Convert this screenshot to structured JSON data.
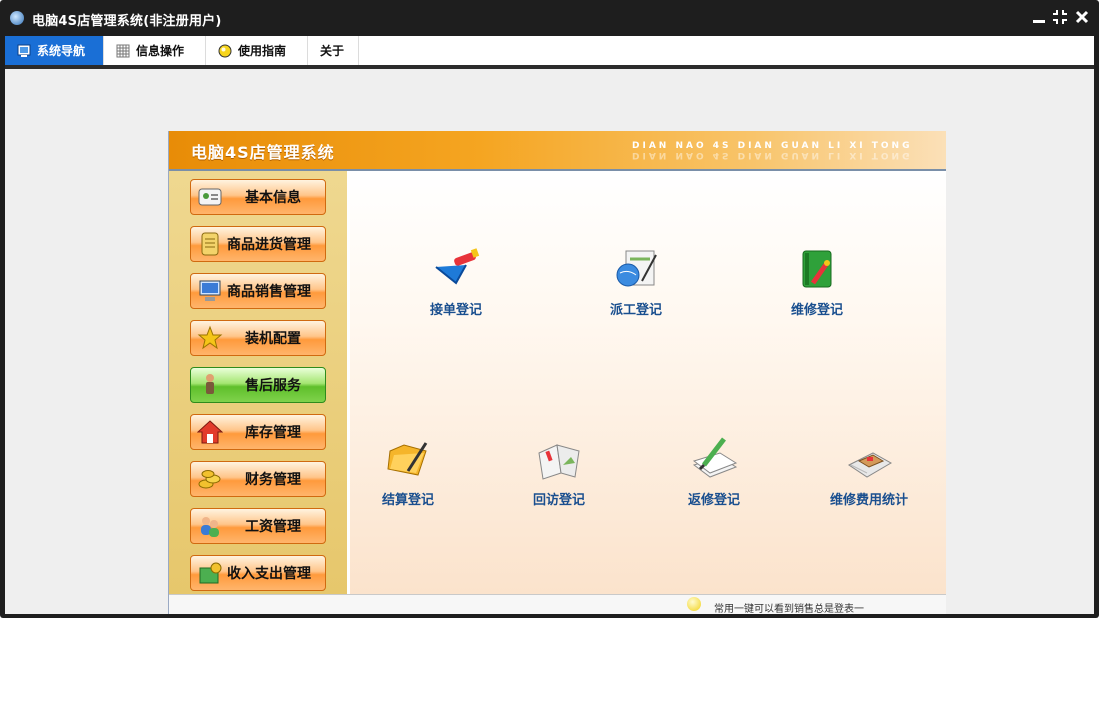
{
  "window": {
    "title": "电脑4S店管理系统(非注册用户)"
  },
  "menu": {
    "items": [
      {
        "label": "系统导航",
        "icon": "monitor-icon"
      },
      {
        "label": "信息操作",
        "icon": "grid-icon"
      },
      {
        "label": "使用指南",
        "icon": "bulb-icon"
      },
      {
        "label": "关于",
        "icon": ""
      }
    ],
    "active_index": 0
  },
  "banner": {
    "title": "电脑4S店管理系统",
    "subtitle": "DIAN NAO 4S DIAN GUAN LI XI TONG"
  },
  "sidebar": {
    "items": [
      {
        "label": "基本信息",
        "icon": "id-card-icon"
      },
      {
        "label": "商品进货管理",
        "icon": "document-icon"
      },
      {
        "label": "商品销售管理",
        "icon": "computer-icon"
      },
      {
        "label": "装机配置",
        "icon": "star-icon"
      },
      {
        "label": "售后服务",
        "icon": "person-icon"
      },
      {
        "label": "库存管理",
        "icon": "house-icon"
      },
      {
        "label": "财务管理",
        "icon": "coins-icon"
      },
      {
        "label": "工资管理",
        "icon": "users-icon"
      },
      {
        "label": "收入支出管理",
        "icon": "money-box-icon"
      }
    ],
    "selected_index": 4
  },
  "functions": {
    "items": [
      {
        "label": "接单登记",
        "icon": "clipboard-pencil-icon"
      },
      {
        "label": "派工登记",
        "icon": "globe-document-icon"
      },
      {
        "label": "维修登记",
        "icon": "green-book-icon"
      },
      {
        "label": "结算登记",
        "icon": "folder-pen-icon"
      },
      {
        "label": "回访登记",
        "icon": "open-book-icon"
      },
      {
        "label": "返修登记",
        "icon": "notepad-pencil-icon"
      },
      {
        "label": "维修费用统计",
        "icon": "calculator-icon"
      }
    ]
  },
  "status": {
    "text": "常用一键可以看到销售总是登表一"
  },
  "colors": {
    "accent": "#1a6fd6",
    "banner": "#f5a521",
    "selected_button": "#5fbf2b",
    "label_blue": "#1a4f8f"
  }
}
